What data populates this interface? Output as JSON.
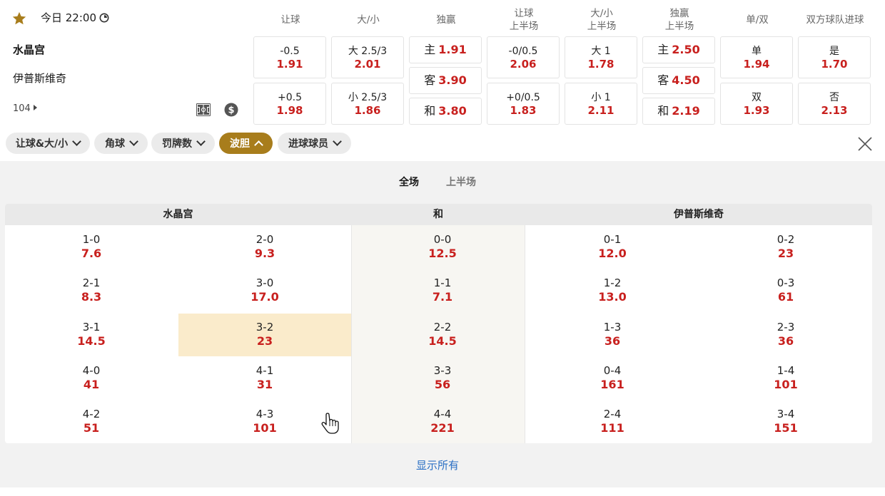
{
  "match": {
    "time": "今日 22:00",
    "home": "水晶宫",
    "away": "伊普斯维奇",
    "more_count": "104"
  },
  "columns": [
    "让球",
    "大/小",
    "独赢",
    "让球\n上半场",
    "大/小\n上半场",
    "独赢\n上半场",
    "单/双",
    "双方球队进球"
  ],
  "markets": {
    "handicap": [
      {
        "label": "-0.5",
        "odd": "1.91"
      },
      {
        "label": "+0.5",
        "odd": "1.98"
      }
    ],
    "overunder": [
      {
        "label": "大 2.5/3",
        "odd": "2.01"
      },
      {
        "label": "小 2.5/3",
        "odd": "1.86"
      }
    ],
    "moneyline": [
      {
        "label": "主",
        "odd": "1.91"
      },
      {
        "label": "客",
        "odd": "3.90"
      },
      {
        "label": "和",
        "odd": "3.80"
      }
    ],
    "handicap_1h": [
      {
        "label": "-0/0.5",
        "odd": "2.06"
      },
      {
        "label": "+0/0.5",
        "odd": "1.83"
      }
    ],
    "overunder_1h": [
      {
        "label": "大 1",
        "odd": "1.78"
      },
      {
        "label": "小 1",
        "odd": "2.11"
      }
    ],
    "moneyline_1h": [
      {
        "label": "主",
        "odd": "2.50"
      },
      {
        "label": "客",
        "odd": "4.50"
      },
      {
        "label": "和",
        "odd": "2.19"
      }
    ],
    "oddeven": [
      {
        "label": "单",
        "odd": "1.94"
      },
      {
        "label": "双",
        "odd": "1.93"
      }
    ],
    "btts": [
      {
        "label": "是",
        "odd": "1.70"
      },
      {
        "label": "否",
        "odd": "2.13"
      }
    ]
  },
  "filters": [
    {
      "label": "让球&大/小",
      "active": false
    },
    {
      "label": "角球",
      "active": false
    },
    {
      "label": "罚牌数",
      "active": false
    },
    {
      "label": "波胆",
      "active": true
    },
    {
      "label": "进球球员",
      "active": false
    }
  ],
  "tabs": {
    "full": "全场",
    "half": "上半场"
  },
  "correct_score": {
    "headers": {
      "home": "水晶宫",
      "draw": "和",
      "away": "伊普斯维奇"
    },
    "columns": [
      [
        {
          "s": "1-0",
          "o": "7.6"
        },
        {
          "s": "2-1",
          "o": "8.3"
        },
        {
          "s": "3-1",
          "o": "14.5"
        },
        {
          "s": "4-0",
          "o": "41"
        },
        {
          "s": "4-2",
          "o": "51"
        }
      ],
      [
        {
          "s": "2-0",
          "o": "9.3"
        },
        {
          "s": "3-0",
          "o": "17.0"
        },
        {
          "s": "3-2",
          "o": "23"
        },
        {
          "s": "4-1",
          "o": "31"
        },
        {
          "s": "4-3",
          "o": "101"
        }
      ],
      [
        {
          "s": "0-0",
          "o": "12.5"
        },
        {
          "s": "1-1",
          "o": "7.1"
        },
        {
          "s": "2-2",
          "o": "14.5"
        },
        {
          "s": "3-3",
          "o": "56"
        },
        {
          "s": "4-4",
          "o": "221"
        }
      ],
      [
        {
          "s": "0-1",
          "o": "12.0"
        },
        {
          "s": "1-2",
          "o": "13.0"
        },
        {
          "s": "1-3",
          "o": "36"
        },
        {
          "s": "0-4",
          "o": "161"
        },
        {
          "s": "2-4",
          "o": "111"
        }
      ],
      [
        {
          "s": "0-2",
          "o": "23"
        },
        {
          "s": "0-3",
          "o": "61"
        },
        {
          "s": "2-3",
          "o": "36"
        },
        {
          "s": "1-4",
          "o": "101"
        },
        {
          "s": "3-4",
          "o": "151"
        }
      ]
    ]
  },
  "show_all": "显示所有",
  "colors": {
    "odd": "#c8201e",
    "accent": "#a87d1c",
    "highlight": "#faebcb",
    "link": "#2a6fc4"
  }
}
